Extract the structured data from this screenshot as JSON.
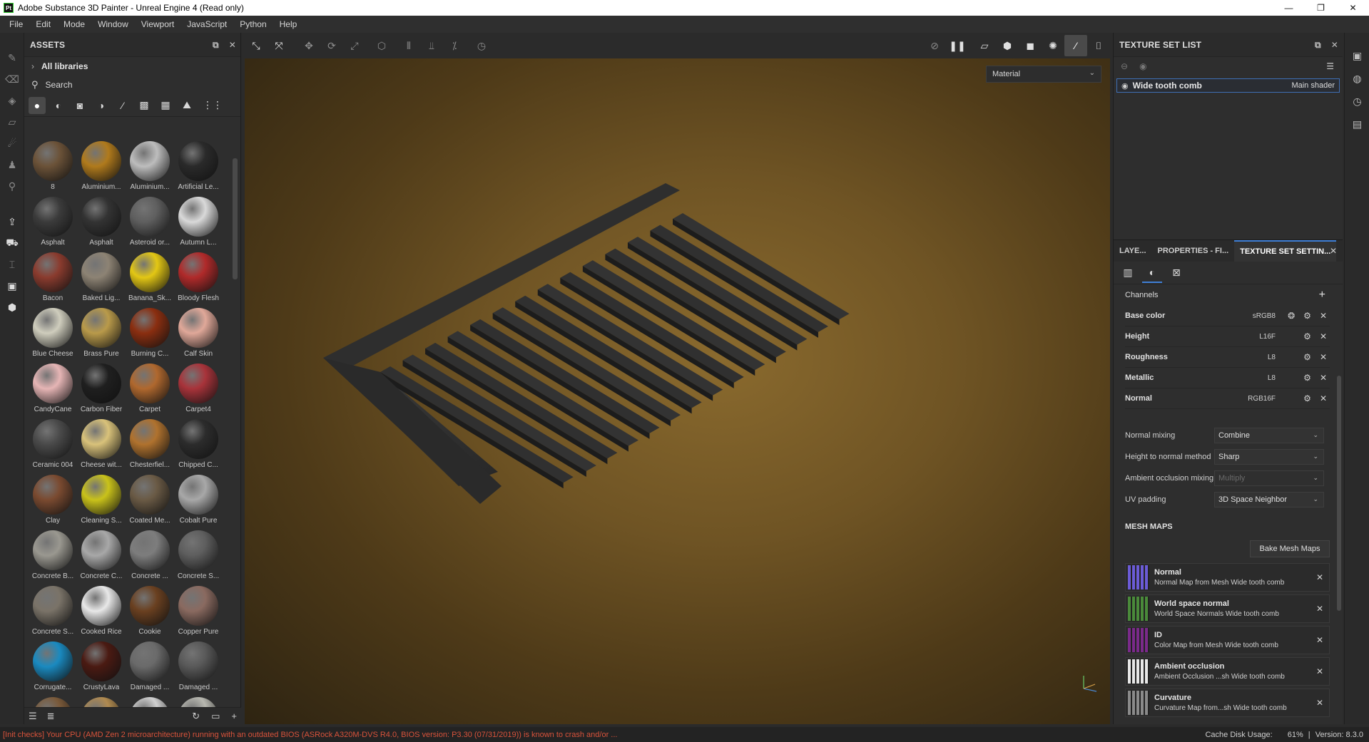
{
  "window": {
    "title": "Adobe Substance 3D Painter - Unreal Engine 4 (Read only)",
    "logo": "Pt",
    "minimize": "—",
    "maximize": "❐",
    "close": "✕"
  },
  "menu": [
    "File",
    "Edit",
    "Mode",
    "Window",
    "Viewport",
    "JavaScript",
    "Python",
    "Help"
  ],
  "assets": {
    "title": "ASSETS",
    "libraries": "All libraries",
    "search_placeholder": "Search",
    "items": [
      {
        "label": "8",
        "color": "#6b5238"
      },
      {
        "label": "Aluminium...",
        "color": "#b07a1c"
      },
      {
        "label": "Aluminium...",
        "color": "#bdbdbd"
      },
      {
        "label": "Artificial Le...",
        "color": "#2a2a2a"
      },
      {
        "label": "Asphalt",
        "color": "#3b3b3b"
      },
      {
        "label": "Asphalt",
        "color": "#333333"
      },
      {
        "label": "Asteroid or...",
        "color": "#5f5f5f"
      },
      {
        "label": "Autumn L...",
        "color": "#d9d9d9"
      },
      {
        "label": "Bacon",
        "color": "#8a3b2e"
      },
      {
        "label": "Baked Lig...",
        "color": "#8d8374"
      },
      {
        "label": "Banana_Sk...",
        "color": "#e3c714"
      },
      {
        "label": "Bloody Flesh",
        "color": "#b02a2a"
      },
      {
        "label": "Blue Cheese",
        "color": "#cfcdbd"
      },
      {
        "label": "Brass Pure",
        "color": "#b99a4a"
      },
      {
        "label": "Burning C...",
        "color": "#8a2e10"
      },
      {
        "label": "Calf Skin",
        "color": "#e0a899"
      },
      {
        "label": "CandyCane",
        "color": "#e6b5b5"
      },
      {
        "label": "Carbon Fiber",
        "color": "#1f1f1f"
      },
      {
        "label": "Carpet",
        "color": "#b0682e"
      },
      {
        "label": "Carpet4",
        "color": "#a8333a"
      },
      {
        "label": "Ceramic 004",
        "color": "#4a4a4a"
      },
      {
        "label": "Cheese wit...",
        "color": "#d9c27a"
      },
      {
        "label": "Chesterfiel...",
        "color": "#b0722e"
      },
      {
        "label": "Chipped C...",
        "color": "#2c2c2c"
      },
      {
        "label": "Clay",
        "color": "#7a4a30"
      },
      {
        "label": "Cleaning S...",
        "color": "#c9c21a"
      },
      {
        "label": "Coated Me...",
        "color": "#6a5a45"
      },
      {
        "label": "Cobalt Pure",
        "color": "#a8a8a8"
      },
      {
        "label": "Concrete B...",
        "color": "#9a9890"
      },
      {
        "label": "Concrete C...",
        "color": "#a8a8a8"
      },
      {
        "label": "Concrete ...",
        "color": "#7d7d7d"
      },
      {
        "label": "Concrete S...",
        "color": "#5e5e5e"
      },
      {
        "label": "Concrete S...",
        "color": "#7a7368"
      },
      {
        "label": "Cooked Rice",
        "color": "#e8e8e8"
      },
      {
        "label": "Cookie",
        "color": "#6a4020"
      },
      {
        "label": "Copper Pure",
        "color": "#8a6a60"
      },
      {
        "label": "Corrugate...",
        "color": "#1a8ac0"
      },
      {
        "label": "CrustyLava",
        "color": "#4a1a12"
      },
      {
        "label": "Damaged ...",
        "color": "#6a6a6a"
      },
      {
        "label": "Damaged ...",
        "color": "#595959"
      },
      {
        "label": "",
        "color": "#7a5a3a"
      },
      {
        "label": "",
        "color": "#b08a50"
      },
      {
        "label": "",
        "color": "#d0d0d0"
      },
      {
        "label": "",
        "color": "#b8b8b0"
      }
    ]
  },
  "viewport": {
    "material_select": "Material"
  },
  "texture_set_list": {
    "title": "TEXTURE SET LIST",
    "item_name": "Wide tooth comb",
    "item_shader": "Main shader"
  },
  "settings_tabs": [
    "LAYE...",
    "PROPERTIES - FI...",
    "TEXTURE SET SETTIN..."
  ],
  "texture_set_settings": {
    "channels_label": "Channels",
    "channels": [
      {
        "name": "Base color",
        "format": "sRGB8"
      },
      {
        "name": "Height",
        "format": "L16F"
      },
      {
        "name": "Roughness",
        "format": "L8"
      },
      {
        "name": "Metallic",
        "format": "L8"
      },
      {
        "name": "Normal",
        "format": "RGB16F"
      }
    ],
    "settings": [
      {
        "label": "Normal mixing",
        "value": "Combine"
      },
      {
        "label": "Height to normal method",
        "value": "Sharp"
      },
      {
        "label": "Ambient occlusion mixing",
        "value": "Multiply"
      },
      {
        "label": "UV padding",
        "value": "3D Space Neighbor"
      }
    ],
    "mesh_maps_label": "MESH MAPS",
    "bake_button": "Bake Mesh Maps",
    "mesh_maps": [
      {
        "name": "Normal",
        "desc": "Normal Map from Mesh Wide tooth comb",
        "color": "#6b5bd6"
      },
      {
        "name": "World space normal",
        "desc": "World Space Normals Wide tooth comb",
        "color": "#4a8a3a"
      },
      {
        "name": "ID",
        "desc": "Color Map from Mesh Wide tooth comb",
        "color": "#7a2a8a"
      },
      {
        "name": "Ambient occlusion",
        "desc": "Ambient Occlusion ...sh Wide tooth comb",
        "color": "#e8e8e8"
      },
      {
        "name": "Curvature",
        "desc": "Curvature Map from...sh Wide tooth comb",
        "color": "#8a8a8a"
      }
    ]
  },
  "status": {
    "message": "[Init checks] Your CPU (AMD Zen 2 microarchitecture) running with an outdated BIOS (ASRock A320M-DVS R4.0, BIOS version: P3.30 (07/31/2019)) is known to crash and/or ...",
    "cache": "Cache Disk Usage:",
    "cache_value": "61%",
    "version": "Version: 8.3.0"
  }
}
